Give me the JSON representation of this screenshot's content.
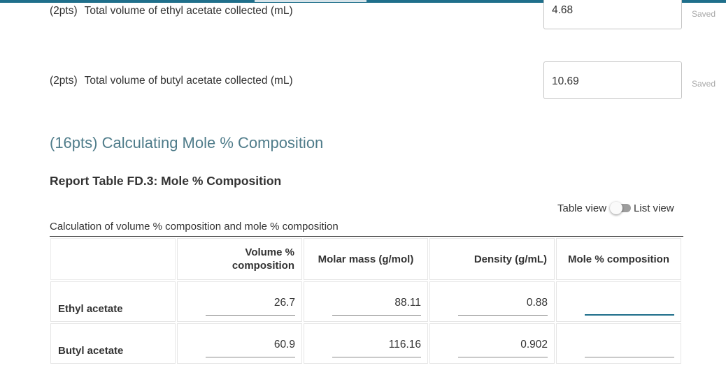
{
  "questions": [
    {
      "points": "(2pts)",
      "label": "Total volume of ethyl acetate collected (mL)",
      "value": "4.68",
      "status": "Saved"
    },
    {
      "points": "(2pts)",
      "label": "Total volume of butyl acetate collected (mL)",
      "value": "10.69",
      "status": "Saved"
    }
  ],
  "section": {
    "title": "(16pts) Calculating Mole % Composition"
  },
  "report_table": {
    "title": "Report Table FD.3: Mole % Composition",
    "view_toggle": {
      "left_label": "Table view",
      "right_label": "List view",
      "selected": "Table view"
    },
    "caption": "Calculation of volume % composition and mole % composition",
    "headers": [
      "",
      "Volume % composition",
      "Molar mass (g/mol)",
      "Density (g/mL)",
      "Mole % composition"
    ],
    "rows": [
      {
        "label": "Ethyl acetate",
        "volume_pct": "26.7",
        "molar_mass": "88.11",
        "density": "0.88",
        "mole_pct": ""
      },
      {
        "label": "Butyl acetate",
        "volume_pct": "60.9",
        "molar_mass": "116.16",
        "density": "0.902",
        "mole_pct": ""
      }
    ]
  },
  "colors": {
    "accent": "#1f6f8b",
    "section_title": "#4f7c8a",
    "saved_text": "#a8a8a8"
  }
}
